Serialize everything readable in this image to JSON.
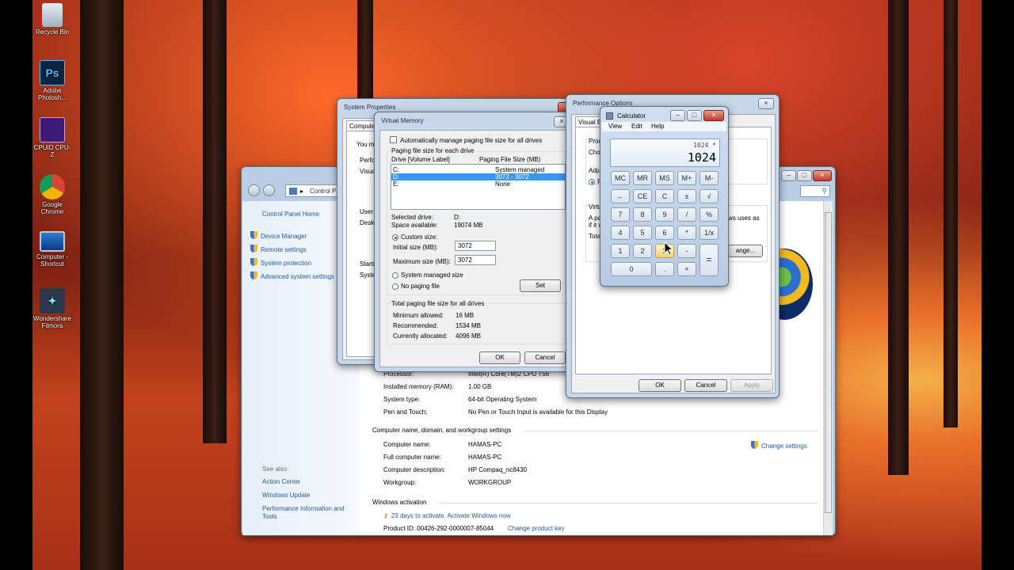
{
  "desktop": {
    "icons": [
      {
        "label": "Recycle Bin"
      },
      {
        "label": "Adobe Photosh...",
        "badge": "Ps"
      },
      {
        "label": "CPUID CPU-Z"
      },
      {
        "label": "Google Chrome"
      },
      {
        "label": "Computer - Shortcut"
      },
      {
        "label": "Wondershare Filmora"
      }
    ]
  },
  "control_panel": {
    "address": "Control P",
    "home": "Control Panel Home",
    "nav": [
      "Device Manager",
      "Remote settings",
      "System protection",
      "Advanced system settings"
    ],
    "see_also": "See also",
    "see_also_links": [
      "Action Center",
      "Windows Update",
      "Performance Information and Tools"
    ],
    "system_rows": [
      {
        "label": "Processor:",
        "value": "Intel(R) Core(TM)2 CPU        T56"
      },
      {
        "label": "Installed memory (RAM):",
        "value": "1.00 GB"
      },
      {
        "label": "System type:",
        "value": "64-bit Operating System"
      },
      {
        "label": "Pen and Touch:",
        "value": "No Pen or Touch Input is available for this Display"
      }
    ],
    "name_heading": "Computer name, domain, and workgroup settings",
    "name_rows": [
      {
        "label": "Computer name:",
        "value": "HAMAS-PC"
      },
      {
        "label": "Full computer name:",
        "value": "HAMAS-PC"
      },
      {
        "label": "Computer description:",
        "value": "HP Compaq_nc8430"
      },
      {
        "label": "Workgroup:",
        "value": "WORKGROUP"
      }
    ],
    "change_settings": "Change settings",
    "activation_heading": "Windows activation",
    "activation_text": "23 days to activate. Activate Windows now",
    "product_id": "Product ID: 00426-292-0000007-85044",
    "change_key": "Change product key"
  },
  "system_properties": {
    "title": "System Properties",
    "tab": "Computer",
    "fragments": [
      "You m",
      "Perfor",
      "Visual",
      "User P",
      "Deskt",
      "Startu",
      "Syster"
    ]
  },
  "virtual_memory": {
    "title": "Virtual Memory",
    "auto_manage": "Automatically manage paging file size for all drives",
    "group_label": "Paging file size for each drive",
    "col_drive": "Drive  [Volume Label]",
    "col_size": "Paging File Size (MB)",
    "drives": [
      {
        "drive": "C:",
        "size": "System managed",
        "selected": false
      },
      {
        "drive": "D:",
        "size": "3072 - 3072",
        "selected": true
      },
      {
        "drive": "E:",
        "size": "None",
        "selected": false
      }
    ],
    "selected_drive_label": "Selected drive:",
    "selected_drive_value": "D:",
    "space_label": "Space available:",
    "space_value": "19074 MB",
    "custom_size": "Custom size:",
    "initial_label": "Initial size (MB):",
    "initial_value": "3072",
    "max_label": "Maximum size (MB):",
    "max_value": "3072",
    "system_managed": "System managed size",
    "no_paging": "No paging file",
    "set": "Set",
    "total_label": "Total paging file size for all drives",
    "min_label": "Minimum allowed:",
    "min_value": "16 MB",
    "rec_label": "Recommended:",
    "rec_value": "1534 MB",
    "cur_label": "Currently allocated:",
    "cur_value": "4096 MB",
    "ok": "OK",
    "cancel": "Cancel"
  },
  "performance_options": {
    "title": "Performance Options",
    "tab": "Visual Ef",
    "fragments": [
      "Proce",
      "Choo",
      "Adju",
      "P",
      "Virtu",
      "A pag",
      "if it w",
      "Tota",
      "ws uses as"
    ],
    "change": "ange...",
    "ok": "OK",
    "cancel": "Cancel",
    "apply": "Apply"
  },
  "calculator": {
    "title": "Calculator",
    "menu": [
      "View",
      "Edit",
      "Help"
    ],
    "expression": "1024 *",
    "display": "1024",
    "rows": [
      [
        "MC",
        "MR",
        "MS",
        "M+",
        "M-"
      ],
      [
        "←",
        "CE",
        "C",
        "±",
        "√"
      ],
      [
        "7",
        "8",
        "9",
        "/",
        "%"
      ],
      [
        "4",
        "5",
        "6",
        "*",
        "1/x"
      ],
      [
        "1",
        "2",
        "3",
        "-",
        "="
      ],
      [
        "0",
        ".",
        "+"
      ]
    ]
  }
}
